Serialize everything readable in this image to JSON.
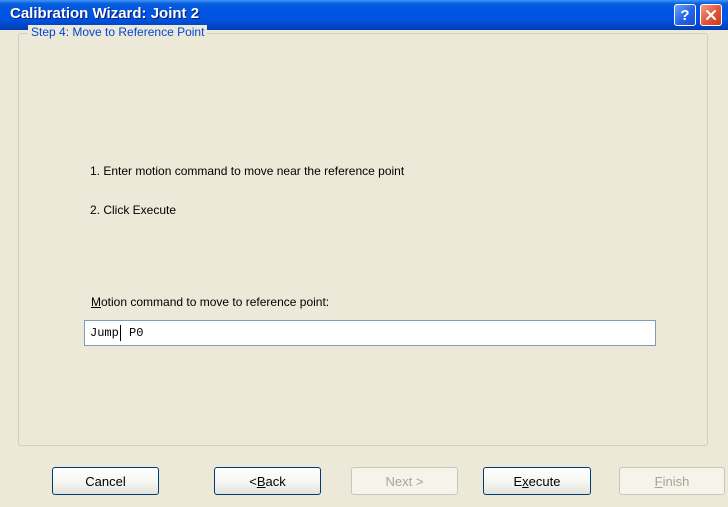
{
  "window": {
    "title": "Calibration Wizard: Joint 2",
    "help_glyph": "?",
    "icons": {
      "help": "help-icon",
      "close": "close-icon"
    }
  },
  "step": {
    "title": "Step 4: Move to Reference Point",
    "instructions": [
      "1. Enter motion command to move near the reference point",
      "2. Click Execute"
    ],
    "field": {
      "label_mnemonic": "M",
      "label_rest": "otion command to move to reference point:",
      "value_before_caret": "Jump",
      "value_after_caret": " P0"
    }
  },
  "buttons": {
    "cancel": "Cancel",
    "back_prefix": "< ",
    "back_mnemonic": "B",
    "back_rest": "ack",
    "next": "Next >",
    "execute_prefix": "E",
    "execute_mnemonic": "x",
    "execute_rest": "ecute",
    "finish_mnemonic": "F",
    "finish_rest": "inish"
  },
  "colors": {
    "title_bar": "#0054e3",
    "group_label": "#0046d5",
    "face": "#ece9d8"
  }
}
